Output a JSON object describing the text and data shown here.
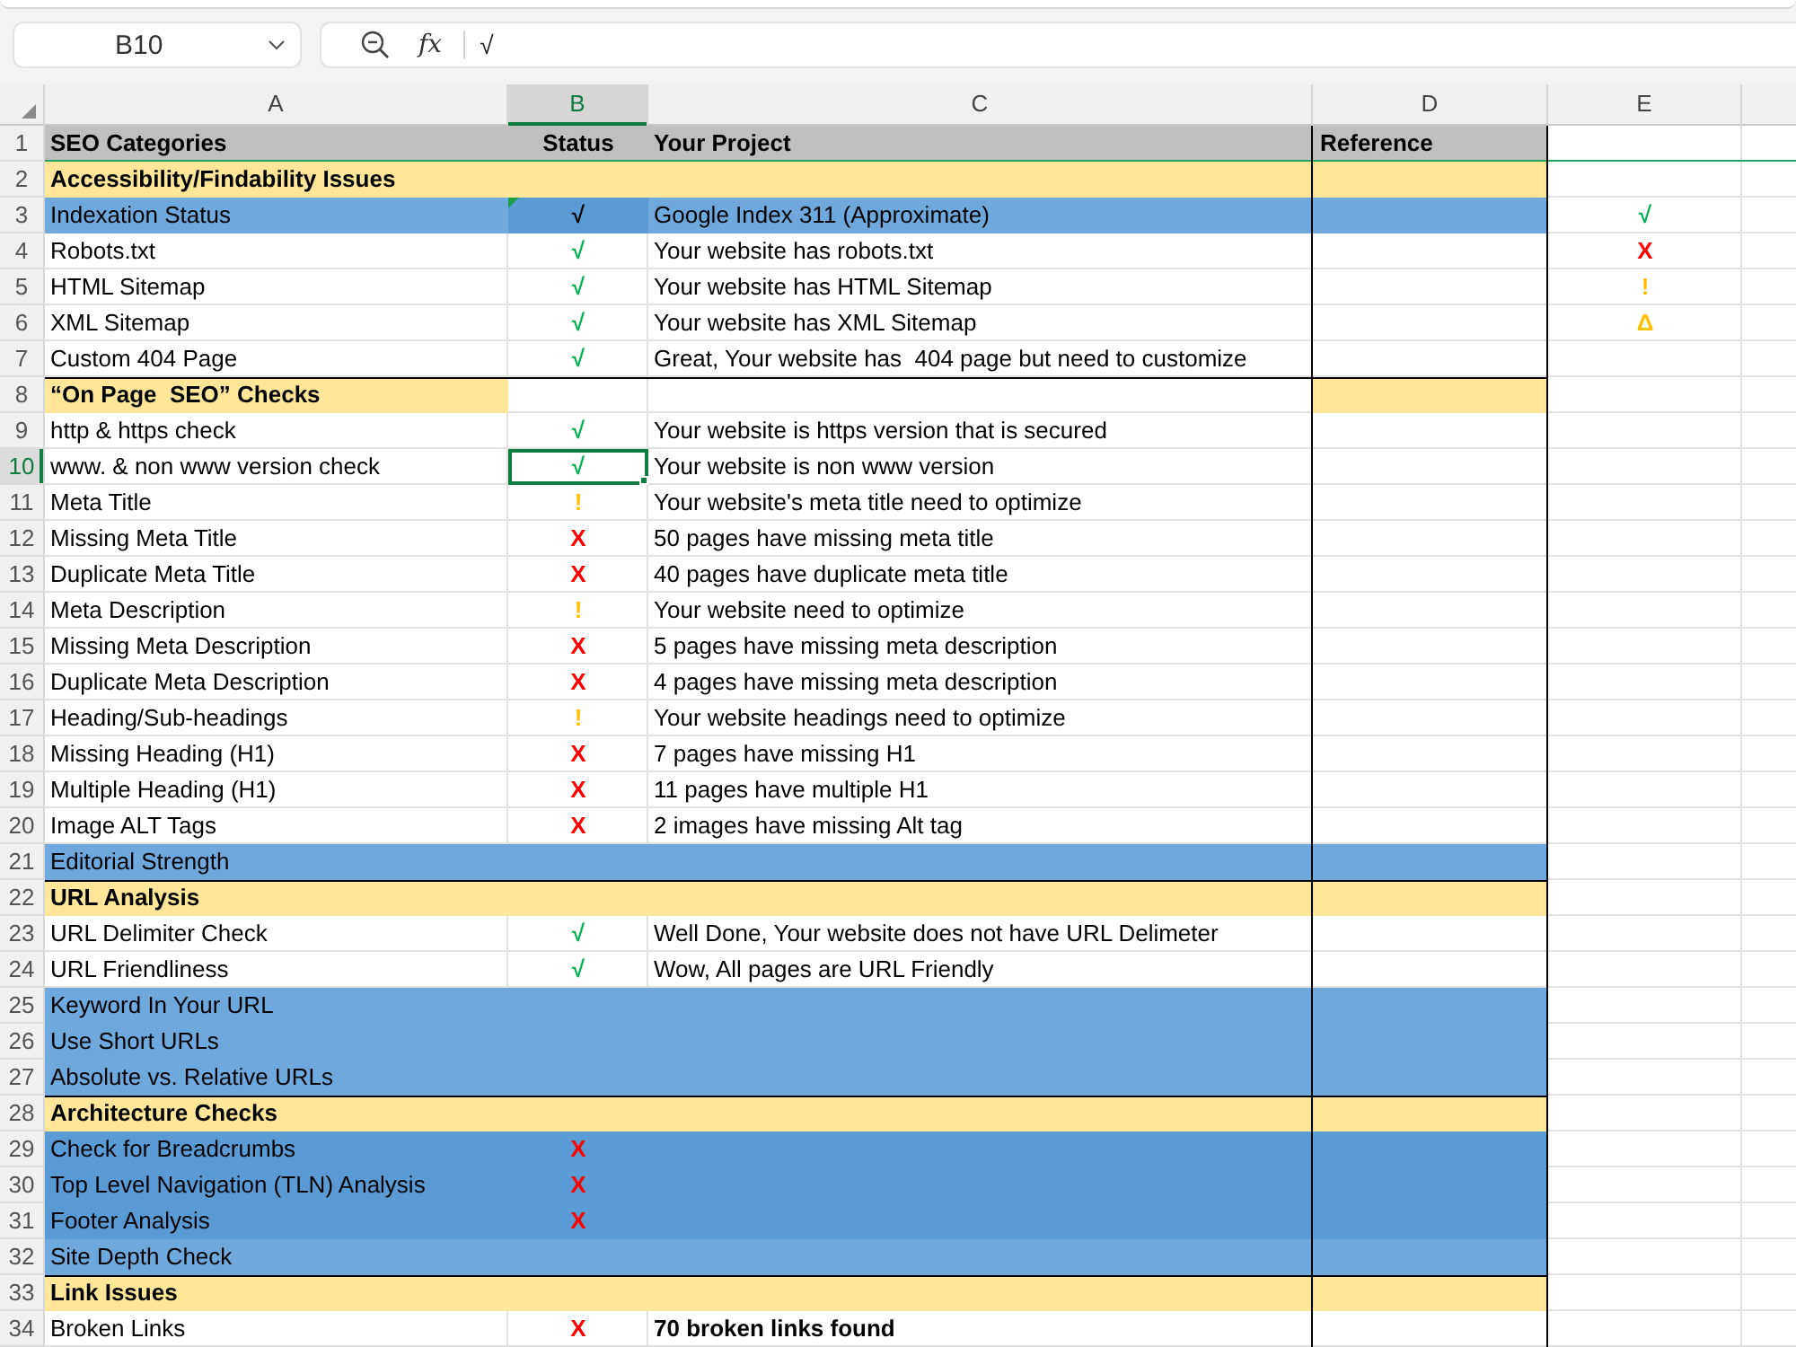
{
  "formula_bar": {
    "name_box": "B10",
    "function_label": "fx",
    "formula": "√"
  },
  "columns": [
    {
      "label": "A",
      "selected": false
    },
    {
      "label": "B",
      "selected": true
    },
    {
      "label": "C",
      "selected": false
    },
    {
      "label": "D",
      "selected": false
    },
    {
      "label": "E",
      "selected": false
    }
  ],
  "rows": [
    {
      "number": "1",
      "kind": "header",
      "selected": false,
      "category": "SEO Categories",
      "status": {
        "text": "Status",
        "kind": "heading"
      },
      "project": "Your Project",
      "reference": "Reference",
      "color": "#bfbfbf"
    },
    {
      "number": "2",
      "kind": "section",
      "selected": false,
      "category": "Accessibility/Findability Issues",
      "color": "#ffe699"
    },
    {
      "number": "3",
      "kind": "item",
      "selected": false,
      "category": "Indexation Status",
      "status": {
        "text": "√",
        "kind": "plain",
        "color": "#5b9bd5"
      },
      "status_flag": true,
      "project": "Google Index 311 (Approximate)",
      "color": "#6fa8dc",
      "legend": {
        "text": "√",
        "kind": "pass"
      }
    },
    {
      "number": "4",
      "kind": "item",
      "selected": false,
      "category": "Robots.txt",
      "status": {
        "text": "√",
        "kind": "pass"
      },
      "project": "Your website has robots.txt",
      "legend": {
        "text": "X",
        "kind": "fail"
      }
    },
    {
      "number": "5",
      "kind": "item",
      "selected": false,
      "category": "HTML Sitemap",
      "status": {
        "text": "√",
        "kind": "pass"
      },
      "project": "Your website has HTML Sitemap",
      "legend": {
        "text": "!",
        "kind": "warn"
      }
    },
    {
      "number": "6",
      "kind": "item",
      "selected": false,
      "category": "XML Sitemap",
      "status": {
        "text": "√",
        "kind": "pass"
      },
      "project": "Your website has XML Sitemap",
      "legend": {
        "text": "Δ",
        "kind": "caution"
      }
    },
    {
      "number": "7",
      "kind": "item",
      "selected": false,
      "category": "Custom 404 Page",
      "status": {
        "text": "√",
        "kind": "pass"
      },
      "project": "Great, Your website has  404 page but need to customize"
    },
    {
      "number": "8",
      "kind": "section",
      "selected": false,
      "category": "“On Page  SEO” Checks",
      "color": "#ffe699",
      "split_fill": true
    },
    {
      "number": "9",
      "kind": "item",
      "selected": false,
      "category": "http & https check",
      "status": {
        "text": "√",
        "kind": "pass"
      },
      "project": "Your website is https version that is secured"
    },
    {
      "number": "10",
      "kind": "item",
      "selected": true,
      "category": "www. & non www version check",
      "status": {
        "text": "√",
        "kind": "pass"
      },
      "project": "Your website is non www version"
    },
    {
      "number": "11",
      "kind": "item",
      "selected": false,
      "category": "Meta Title",
      "status": {
        "text": "!",
        "kind": "warn"
      },
      "project": "Your website's meta title need to optimize"
    },
    {
      "number": "12",
      "kind": "item",
      "selected": false,
      "category": "Missing Meta Title",
      "status": {
        "text": "X",
        "kind": "fail"
      },
      "project": "50 pages have missing meta title"
    },
    {
      "number": "13",
      "kind": "item",
      "selected": false,
      "category": "Duplicate Meta Title",
      "status": {
        "text": "X",
        "kind": "fail"
      },
      "project": "40 pages have duplicate meta title"
    },
    {
      "number": "14",
      "kind": "item",
      "selected": false,
      "category": "Meta Description",
      "status": {
        "text": "!",
        "kind": "warn"
      },
      "project": "Your website need to optimize"
    },
    {
      "number": "15",
      "kind": "item",
      "selected": false,
      "category": "Missing Meta Description",
      "status": {
        "text": "X",
        "kind": "fail"
      },
      "project": "5 pages have missing meta description"
    },
    {
      "number": "16",
      "kind": "item",
      "selected": false,
      "category": "Duplicate Meta Description",
      "status": {
        "text": "X",
        "kind": "fail"
      },
      "project": "4 pages have missing meta description"
    },
    {
      "number": "17",
      "kind": "item",
      "selected": false,
      "category": "Heading/Sub-headings",
      "status": {
        "text": "!",
        "kind": "warn"
      },
      "project": "Your website headings need to optimize"
    },
    {
      "number": "18",
      "kind": "item",
      "selected": false,
      "category": "Missing Heading (H1)",
      "status": {
        "text": "X",
        "kind": "fail"
      },
      "project": "7 pages have missing H1"
    },
    {
      "number": "19",
      "kind": "item",
      "selected": false,
      "category": "Multiple Heading (H1)",
      "status": {
        "text": "X",
        "kind": "fail"
      },
      "project": "11 pages have multiple H1"
    },
    {
      "number": "20",
      "kind": "item",
      "selected": false,
      "category": "Image ALT Tags",
      "status": {
        "text": "X",
        "kind": "fail"
      },
      "project": "2 images have missing Alt tag"
    },
    {
      "number": "21",
      "kind": "item",
      "selected": false,
      "category": "Editorial Strength",
      "color": "#6fa8dc"
    },
    {
      "number": "22",
      "kind": "section",
      "selected": false,
      "category": "URL Analysis",
      "color": "#ffe699"
    },
    {
      "number": "23",
      "kind": "item",
      "selected": false,
      "category": "URL Delimiter Check",
      "status": {
        "text": "√",
        "kind": "pass"
      },
      "project": "Well Done, Your website does not have URL Delimeter"
    },
    {
      "number": "24",
      "kind": "item",
      "selected": false,
      "category": "URL Friendliness",
      "status": {
        "text": "√",
        "kind": "pass"
      },
      "project": "Wow, All pages are URL Friendly"
    },
    {
      "number": "25",
      "kind": "item",
      "selected": false,
      "category": "Keyword In Your URL",
      "color": "#6fa8dc"
    },
    {
      "number": "26",
      "kind": "item",
      "selected": false,
      "category": "Use Short URLs",
      "color": "#6fa8dc"
    },
    {
      "number": "27",
      "kind": "item",
      "selected": false,
      "category": "Absolute vs. Relative URLs",
      "color": "#6fa8dc"
    },
    {
      "number": "28",
      "kind": "section",
      "selected": false,
      "category": "Architecture Checks",
      "color": "#ffe699"
    },
    {
      "number": "29",
      "kind": "item",
      "selected": false,
      "category": "Check for Breadcrumbs",
      "status": {
        "text": "X",
        "kind": "fail"
      },
      "color": "#5b9bd5"
    },
    {
      "number": "30",
      "kind": "item",
      "selected": false,
      "category": "Top Level Navigation (TLN) Analysis",
      "status": {
        "text": "X",
        "kind": "fail"
      },
      "color": "#5b9bd5"
    },
    {
      "number": "31",
      "kind": "item",
      "selected": false,
      "category": "Footer Analysis",
      "status": {
        "text": "X",
        "kind": "fail"
      },
      "color": "#5b9bd5"
    },
    {
      "number": "32",
      "kind": "item",
      "selected": false,
      "category": "Site Depth Check",
      "color": "#6fa8dc"
    },
    {
      "number": "33",
      "kind": "section",
      "selected": false,
      "category": "Link Issues",
      "color": "#ffe699"
    },
    {
      "number": "34",
      "kind": "item",
      "selected": false,
      "category": "Broken Links",
      "status": {
        "text": "X",
        "kind": "fail"
      },
      "project": "70 broken links found",
      "project_bold": true
    }
  ]
}
